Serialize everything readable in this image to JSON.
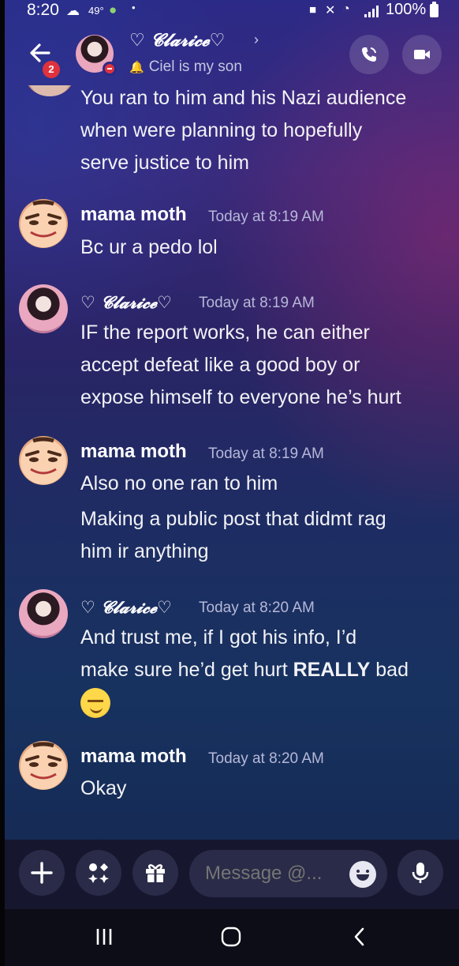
{
  "status_bar": {
    "time": "8:20",
    "temperature": "49°",
    "battery": "100%"
  },
  "header": {
    "contact_name": "♡ 𝓒𝓵𝓪𝓻𝓲𝓬𝓮♡",
    "contact_status": "Ciel is my son",
    "unread_count": "2",
    "icons": [
      "back-arrow-icon",
      "phone-call-icon",
      "video-camera-icon"
    ]
  },
  "messages": {
    "m0": {
      "lines": [
        "You ran to him and his Nazi audience",
        "when were planning to hopefully",
        "serve justice to him"
      ]
    },
    "m1": {
      "author": "mama moth",
      "time": "Today at 8:19 AM",
      "lines": [
        "Bc ur a pedo lol"
      ]
    },
    "m2": {
      "author": "♡ 𝓒𝓵𝓪𝓻𝓲𝓬𝓮♡",
      "time": "Today at 8:19 AM",
      "lines": [
        "IF the report works, he can either",
        "accept defeat like a good boy or",
        "expose himself to everyone he’s hurt"
      ]
    },
    "m3": {
      "author": "mama moth",
      "time": "Today at 8:19 AM",
      "lines": [
        "Also no one ran to him",
        "Making a public post that didmt rag",
        "him ir anything"
      ]
    },
    "m4": {
      "author": "♡ 𝓒𝓵𝓪𝓻𝓲𝓬𝓮♡",
      "time": "Today at 8:20 AM",
      "line1": "And trust me, if I got his info, I’d",
      "line2_pre": "make sure he’d get hurt ",
      "line2_bold": "REALLY",
      "line2_post": " bad",
      "emoji": "smirk-emoji"
    },
    "m5": {
      "author": "mama moth",
      "time": "Today at 8:20 AM",
      "lines": [
        "Okay"
      ]
    }
  },
  "composer": {
    "placeholder": "Message @...",
    "icons": [
      "plus-icon",
      "apps-icon",
      "gift-icon",
      "emoji-icon",
      "microphone-icon"
    ]
  },
  "nav": {
    "icons": [
      "recent-apps-icon",
      "home-icon",
      "back-icon"
    ]
  },
  "colors": {
    "accent_red": "#e0323c",
    "timestamp": "#b6b8d8",
    "composer_bg": "#16172e"
  }
}
